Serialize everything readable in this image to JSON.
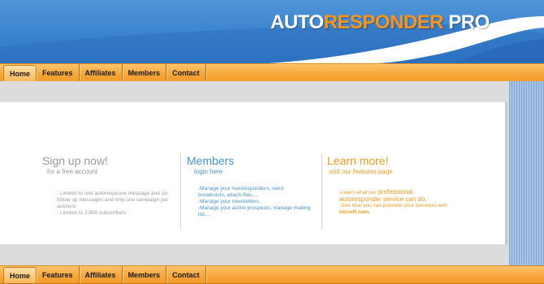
{
  "brand": {
    "logo_part1": "AUTO",
    "logo_part2": "RESPONDER",
    "logo_part3": " PRO",
    "accent": "#f7941d"
  },
  "nav": {
    "items": [
      "Home",
      "Features",
      "Affiliates",
      "Members",
      "Contact"
    ],
    "active": "Home"
  },
  "signup": {
    "title": "Sign up now!",
    "subtitle": "for a free account",
    "bullets": [
      "- Limited to one autoresponse message and six follow up messages and only one campaign per account.",
      "- Limited to 2,500 subscribers"
    ]
  },
  "members": {
    "title": "Members",
    "subtitle": "login here",
    "bullets": [
      "-Manage your Autoresponders, send broadcasts, attach files,...",
      "-Manage your newsletters.",
      "-Manage your active prospects, manage mailing list,..."
    ]
  },
  "learn": {
    "title": "Learn more!",
    "subtitle": "visit our features page",
    "line1_prefix": "-Learn what our ",
    "line1_big": "professional",
    "line2": "autoresponder service can do.",
    "line3": "-See how you can promote your business with ",
    "line3_bold": "bizsoft.com."
  }
}
